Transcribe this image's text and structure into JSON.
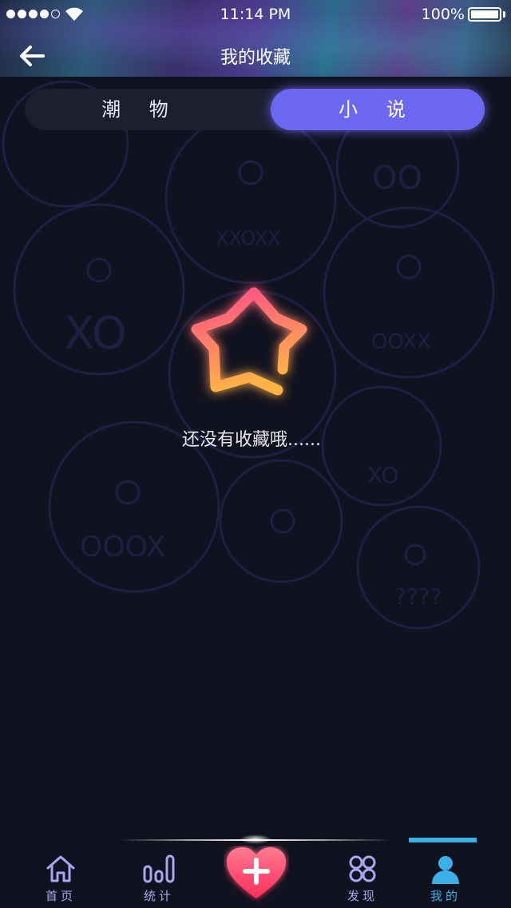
{
  "status_bar": {
    "time": "11:14 PM",
    "battery": "100%",
    "signal_dots": 5,
    "signal_strength": 4,
    "battery_level": 1.0
  },
  "header": {
    "title": "我的收藏",
    "back_icon": "arrow-left-icon"
  },
  "tabs": [
    {
      "label": "潮 物",
      "active": false
    },
    {
      "label": "小 说",
      "active": true
    }
  ],
  "empty_state": {
    "icon": "star-icon",
    "message": "还没有收藏哦......"
  },
  "background_badges": [
    "XXOXX",
    "OOXX",
    "OOOX",
    "XO",
    "????",
    "XO",
    "OO"
  ],
  "bottom_nav": [
    {
      "label": "首页",
      "icon": "home-icon",
      "active": false
    },
    {
      "label": "统计",
      "icon": "bar-chart-icon",
      "active": false
    },
    {
      "label": "发现",
      "icon": "clover-icon",
      "active": false
    },
    {
      "label": "我的",
      "icon": "user-icon",
      "active": true
    }
  ],
  "center_action": {
    "icon": "heart-plus-icon"
  },
  "colors": {
    "background": "#11121f",
    "tab_active": "#6c67f0",
    "nav_active": "#3ab0e6",
    "nav_inactive": "#a9a6f0",
    "star_gradient_start": "#ff4d8a",
    "star_gradient_end": "#ffb347"
  }
}
